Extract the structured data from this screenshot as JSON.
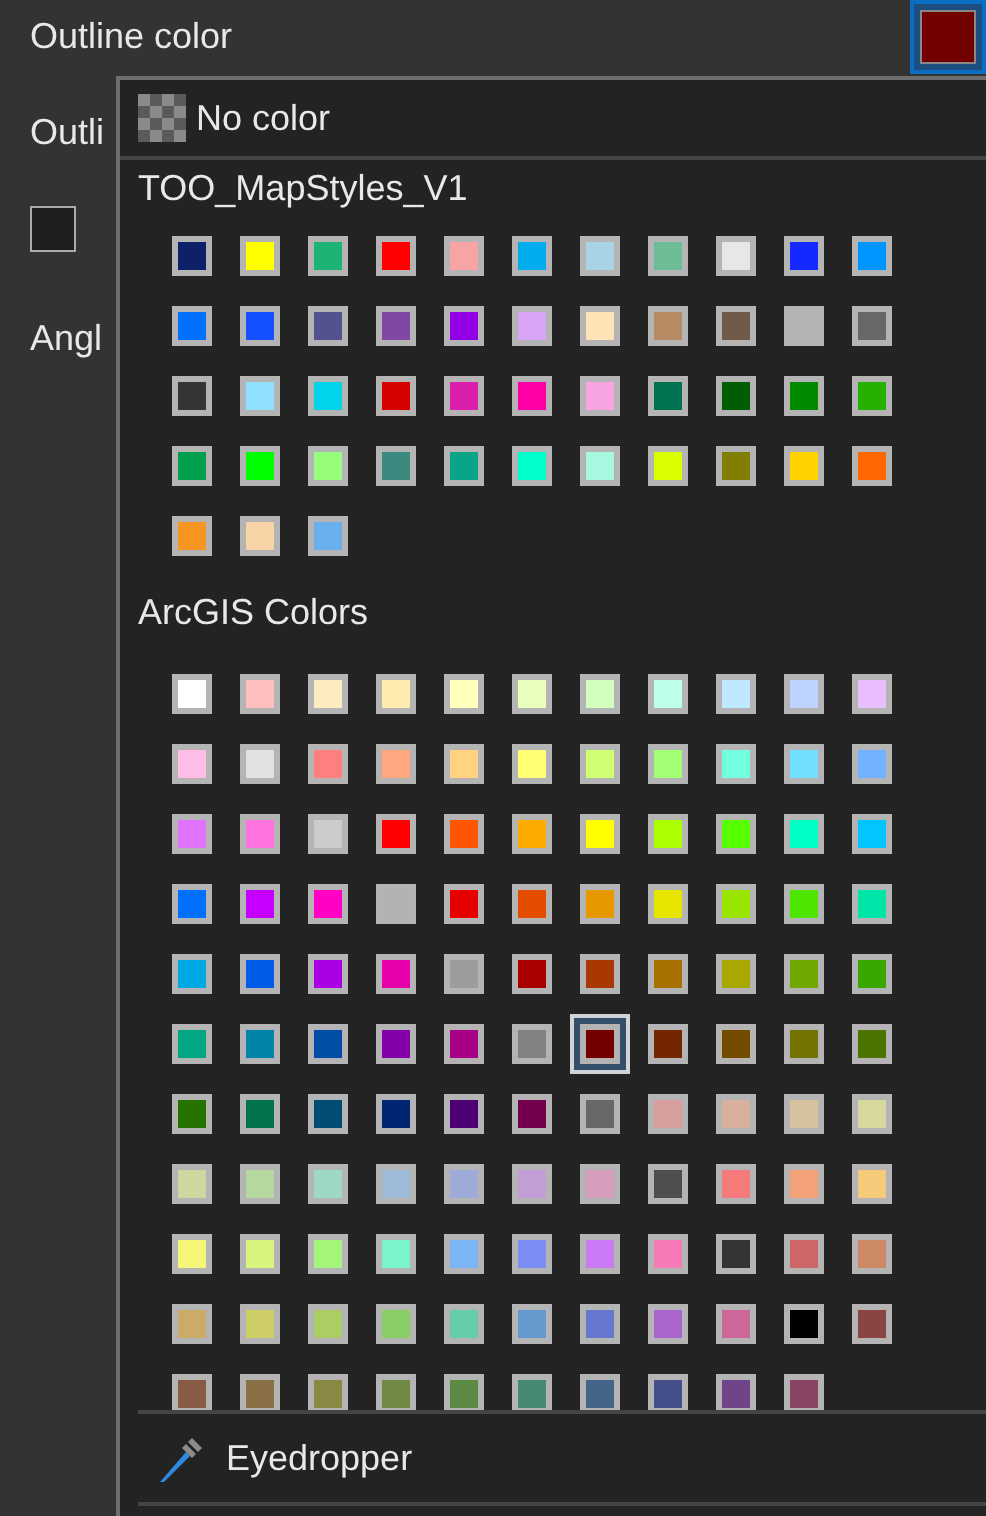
{
  "properties": {
    "outline_color_label": "Outline color",
    "outline_color": {
      "color": "#730000"
    },
    "outline_width_label": "Outli",
    "checkbox": {
      "checked": false
    },
    "angle_label": "Angl"
  },
  "popup": {
    "no_color": "No color",
    "sections": [
      {
        "title": "TOO_MapStyles_V1",
        "swatches": [
          {
            "color": "#0f206a",
            "selected": false
          },
          {
            "color": "#ffff00",
            "selected": false
          },
          {
            "color": "#1db374",
            "selected": false
          },
          {
            "color": "#ff0000",
            "selected": false
          },
          {
            "color": "#f7a4a4",
            "selected": false
          },
          {
            "color": "#00acec",
            "selected": false
          },
          {
            "color": "#a6d4e6",
            "selected": false
          },
          {
            "color": "#6cbd96",
            "selected": false
          },
          {
            "color": "#e6e8e6",
            "selected": false
          },
          {
            "color": "#1428ff",
            "selected": false
          },
          {
            "color": "#0096ff",
            "selected": false
          },
          {
            "color": "#0070ff",
            "selected": false
          },
          {
            "color": "#1450ff",
            "selected": false
          },
          {
            "color": "#53528f",
            "selected": false
          },
          {
            "color": "#8147a4",
            "selected": false
          },
          {
            "color": "#9400e6",
            "selected": false
          },
          {
            "color": "#d8a4f6",
            "selected": false
          },
          {
            "color": "#ffe2b6",
            "selected": false
          },
          {
            "color": "#b68a63",
            "selected": false
          },
          {
            "color": "#715a47",
            "selected": false
          },
          {
            "color": "#b4b4b4",
            "selected": false
          },
          {
            "color": "#686868",
            "selected": false
          },
          {
            "color": "#343634",
            "selected": false
          },
          {
            "color": "#90e1ff",
            "selected": false
          },
          {
            "color": "#00d4e8",
            "selected": false
          },
          {
            "color": "#d60000",
            "selected": false
          },
          {
            "color": "#dc1fab",
            "selected": false
          },
          {
            "color": "#ff00a8",
            "selected": false
          },
          {
            "color": "#f8a4e0",
            "selected": false
          },
          {
            "color": "#007352",
            "selected": false
          },
          {
            "color": "#005c00",
            "selected": false
          },
          {
            "color": "#008a00",
            "selected": false
          },
          {
            "color": "#26b000",
            "selected": false
          },
          {
            "color": "#009f4e",
            "selected": false
          },
          {
            "color": "#00ff00",
            "selected": false
          },
          {
            "color": "#96fe7a",
            "selected": false
          },
          {
            "color": "#3b8a7f",
            "selected": false
          },
          {
            "color": "#0aa489",
            "selected": false
          },
          {
            "color": "#00ffcc",
            "selected": false
          },
          {
            "color": "#a6f8e0",
            "selected": false
          },
          {
            "color": "#d9ff00",
            "selected": false
          },
          {
            "color": "#807f00",
            "selected": false
          },
          {
            "color": "#ffd200",
            "selected": false
          },
          {
            "color": "#ff6700",
            "selected": false
          },
          {
            "color": "#f7951e",
            "selected": false
          },
          {
            "color": "#f8d3a6",
            "selected": false
          },
          {
            "color": "#69afec",
            "selected": false
          }
        ]
      },
      {
        "title": "ArcGIS Colors",
        "swatches": [
          {
            "color": "#ffffff",
            "selected": false
          },
          {
            "color": "#ffbebe",
            "selected": false
          },
          {
            "color": "#ffebc0",
            "selected": false
          },
          {
            "color": "#ffebaf",
            "selected": false
          },
          {
            "color": "#ffffbe",
            "selected": false
          },
          {
            "color": "#e9ffbe",
            "selected": false
          },
          {
            "color": "#d3ffbe",
            "selected": false
          },
          {
            "color": "#beffe8",
            "selected": false
          },
          {
            "color": "#bee8ff",
            "selected": false
          },
          {
            "color": "#bed2ff",
            "selected": false
          },
          {
            "color": "#e8beff",
            "selected": false
          },
          {
            "color": "#ffbee8",
            "selected": false
          },
          {
            "color": "#e1e1e1",
            "selected": false
          },
          {
            "color": "#ff7f7f",
            "selected": false
          },
          {
            "color": "#ffa77f",
            "selected": false
          },
          {
            "color": "#ffd37f",
            "selected": false
          },
          {
            "color": "#ffff73",
            "selected": false
          },
          {
            "color": "#d1ff73",
            "selected": false
          },
          {
            "color": "#a3ff73",
            "selected": false
          },
          {
            "color": "#73ffdf",
            "selected": false
          },
          {
            "color": "#73dfff",
            "selected": false
          },
          {
            "color": "#73b2ff",
            "selected": false
          },
          {
            "color": "#df73ff",
            "selected": false
          },
          {
            "color": "#ff73df",
            "selected": false
          },
          {
            "color": "#cccccc",
            "selected": false
          },
          {
            "color": "#ff0000",
            "selected": false
          },
          {
            "color": "#ff5500",
            "selected": false
          },
          {
            "color": "#ffaa00",
            "selected": false
          },
          {
            "color": "#ffff00",
            "selected": false
          },
          {
            "color": "#aaff00",
            "selected": false
          },
          {
            "color": "#55ff00",
            "selected": false
          },
          {
            "color": "#00ffc5",
            "selected": false
          },
          {
            "color": "#00c5ff",
            "selected": false
          },
          {
            "color": "#0070ff",
            "selected": false
          },
          {
            "color": "#c500ff",
            "selected": false
          },
          {
            "color": "#ff00c5",
            "selected": false
          },
          {
            "color": "#b2b2b2",
            "selected": false
          },
          {
            "color": "#e60000",
            "selected": false
          },
          {
            "color": "#e64c00",
            "selected": false
          },
          {
            "color": "#e69800",
            "selected": false
          },
          {
            "color": "#e6e600",
            "selected": false
          },
          {
            "color": "#98e600",
            "selected": false
          },
          {
            "color": "#4ce600",
            "selected": false
          },
          {
            "color": "#00e6a9",
            "selected": false
          },
          {
            "color": "#00a9e6",
            "selected": false
          },
          {
            "color": "#005ce6",
            "selected": false
          },
          {
            "color": "#a900e6",
            "selected": false
          },
          {
            "color": "#e600a9",
            "selected": false
          },
          {
            "color": "#9c9c9c",
            "selected": false
          },
          {
            "color": "#a80000",
            "selected": false
          },
          {
            "color": "#a83800",
            "selected": false
          },
          {
            "color": "#a87000",
            "selected": false
          },
          {
            "color": "#a8a800",
            "selected": false
          },
          {
            "color": "#70a800",
            "selected": false
          },
          {
            "color": "#38a800",
            "selected": false
          },
          {
            "color": "#00a884",
            "selected": false
          },
          {
            "color": "#0084a8",
            "selected": false
          },
          {
            "color": "#004da8",
            "selected": false
          },
          {
            "color": "#8400a8",
            "selected": false
          },
          {
            "color": "#a80084",
            "selected": false
          },
          {
            "color": "#828282",
            "selected": false
          },
          {
            "color": "#730000",
            "selected": true
          },
          {
            "color": "#732600",
            "selected": false
          },
          {
            "color": "#734c00",
            "selected": false
          },
          {
            "color": "#737300",
            "selected": false
          },
          {
            "color": "#4c7300",
            "selected": false
          },
          {
            "color": "#267300",
            "selected": false
          },
          {
            "color": "#00734c",
            "selected": false
          },
          {
            "color": "#004c73",
            "selected": false
          },
          {
            "color": "#002673",
            "selected": false
          },
          {
            "color": "#4c0073",
            "selected": false
          },
          {
            "color": "#73004c",
            "selected": false
          },
          {
            "color": "#686868",
            "selected": false
          },
          {
            "color": "#d79e9e",
            "selected": false
          },
          {
            "color": "#d7b09e",
            "selected": false
          },
          {
            "color": "#d7c29e",
            "selected": false
          },
          {
            "color": "#d7d79e",
            "selected": false
          },
          {
            "color": "#cdd79e",
            "selected": false
          },
          {
            "color": "#b6d79e",
            "selected": false
          },
          {
            "color": "#9ed7c2",
            "selected": false
          },
          {
            "color": "#9ebbd7",
            "selected": false
          },
          {
            "color": "#9eaad7",
            "selected": false
          },
          {
            "color": "#c29ed7",
            "selected": false
          },
          {
            "color": "#d69dbc",
            "selected": false
          },
          {
            "color": "#4e4e4e",
            "selected": false
          },
          {
            "color": "#f57a7a",
            "selected": false
          },
          {
            "color": "#f5a27a",
            "selected": false
          },
          {
            "color": "#f5ca7a",
            "selected": false
          },
          {
            "color": "#f5f57a",
            "selected": false
          },
          {
            "color": "#d7f57a",
            "selected": false
          },
          {
            "color": "#a5f57a",
            "selected": false
          },
          {
            "color": "#7af5ca",
            "selected": false
          },
          {
            "color": "#7ab6f5",
            "selected": false
          },
          {
            "color": "#7a8ef5",
            "selected": false
          },
          {
            "color": "#ca7af5",
            "selected": false
          },
          {
            "color": "#f57ab6",
            "selected": false
          },
          {
            "color": "#343434",
            "selected": false
          },
          {
            "color": "#cd6666",
            "selected": false
          },
          {
            "color": "#cd8966",
            "selected": false
          },
          {
            "color": "#cdaa66",
            "selected": false
          },
          {
            "color": "#cdcd66",
            "selected": false
          },
          {
            "color": "#abcd66",
            "selected": false
          },
          {
            "color": "#89cd66",
            "selected": false
          },
          {
            "color": "#66cdab",
            "selected": false
          },
          {
            "color": "#6699cd",
            "selected": false
          },
          {
            "color": "#6677cd",
            "selected": false
          },
          {
            "color": "#aa66cd",
            "selected": false
          },
          {
            "color": "#cd6699",
            "selected": false
          },
          {
            "color": "#000000",
            "selected": false
          },
          {
            "color": "#894444",
            "selected": false
          },
          {
            "color": "#895a44",
            "selected": false
          },
          {
            "color": "#897044",
            "selected": false
          },
          {
            "color": "#898944",
            "selected": false
          },
          {
            "color": "#708944",
            "selected": false
          },
          {
            "color": "#5c8944",
            "selected": false
          },
          {
            "color": "#448970",
            "selected": false
          },
          {
            "color": "#446589",
            "selected": false
          },
          {
            "color": "#444f89",
            "selected": false
          },
          {
            "color": "#704489",
            "selected": false
          },
          {
            "color": "#894465",
            "selected": false
          }
        ]
      }
    ],
    "eyedropper": "Eyedropper"
  }
}
